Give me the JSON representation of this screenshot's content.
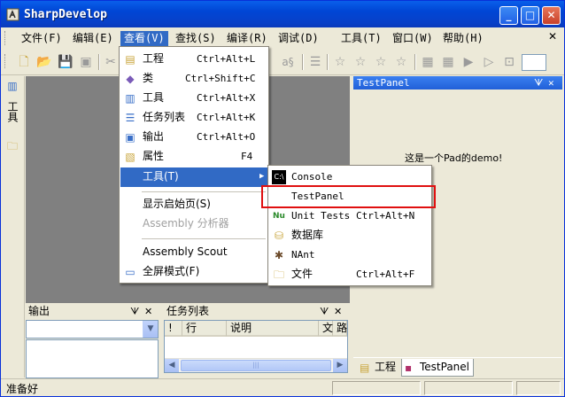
{
  "window": {
    "title": "SharpDevelop",
    "minimize": "_",
    "maximize": "□",
    "close": "✕"
  },
  "menubar": {
    "items": [
      "文件(F)",
      "编辑(E)",
      "查看(V)",
      "查找(S)",
      "编译(R)",
      "调试(D)",
      "工具(T)",
      "窗口(W)",
      "帮助(H)"
    ],
    "close_glyph": "✕"
  },
  "view_menu": {
    "items": [
      {
        "label": "工程",
        "shortcut": "Ctrl+Alt+L",
        "icon": "project-icon"
      },
      {
        "label": "类",
        "shortcut": "Ctrl+Shift+C",
        "icon": "class-icon"
      },
      {
        "label": "工具",
        "shortcut": "Ctrl+Alt+X",
        "icon": "toolbox-icon"
      },
      {
        "label": "任务列表",
        "shortcut": "Ctrl+Alt+K",
        "icon": "tasklist-icon"
      },
      {
        "label": "输出",
        "shortcut": "Ctrl+Alt+O",
        "icon": "output-icon"
      },
      {
        "label": "属性",
        "shortcut": "F4",
        "icon": "properties-icon"
      },
      {
        "label": "工具(T)",
        "shortcut": "",
        "icon": "",
        "submenu_arrow": "▶"
      },
      {
        "label": "显示启始页(S)",
        "shortcut": "",
        "icon": ""
      },
      {
        "label": "Assembly 分析器",
        "shortcut": "",
        "icon": "",
        "disabled": true
      },
      {
        "label": "Assembly Scout",
        "shortcut": "",
        "icon": ""
      },
      {
        "label": "全屏模式(F)",
        "shortcut": "",
        "icon": "fullscreen-icon"
      }
    ]
  },
  "tools_submenu": {
    "items": [
      {
        "label": "Console",
        "shortcut": "",
        "icon": "console-icon"
      },
      {
        "label": "TestPanel",
        "shortcut": "",
        "icon": ""
      },
      {
        "label": "Unit Tests",
        "shortcut": "Ctrl+Alt+N",
        "icon": "nunit-icon"
      },
      {
        "label": "数据库",
        "shortcut": "",
        "icon": "database-icon"
      },
      {
        "label": "NAnt",
        "shortcut": "",
        "icon": "nant-icon"
      },
      {
        "label": "文件",
        "shortcut": "Ctrl+Alt+F",
        "icon": "folder-icon"
      }
    ]
  },
  "left_strip": {
    "tab_label": "工具"
  },
  "output_pad": {
    "title": "输出",
    "pin": "ᗐ",
    "close": "✕"
  },
  "task_pad": {
    "title": "任务列表",
    "pin": "ᗐ",
    "close": "✕",
    "columns": [
      "!",
      "行",
      "说明",
      "文",
      "路"
    ]
  },
  "right_panel": {
    "title": "TestPanel",
    "pin": "ᗐ",
    "close": "✕",
    "demo_text": "这是一个Pad的demo!",
    "tabs": [
      "工程",
      "TestPanel"
    ]
  },
  "status": {
    "text": "准备好"
  },
  "colors": {
    "accent": "#316ac5",
    "highlight_border": "#e01010",
    "doc_area": "#808080"
  }
}
